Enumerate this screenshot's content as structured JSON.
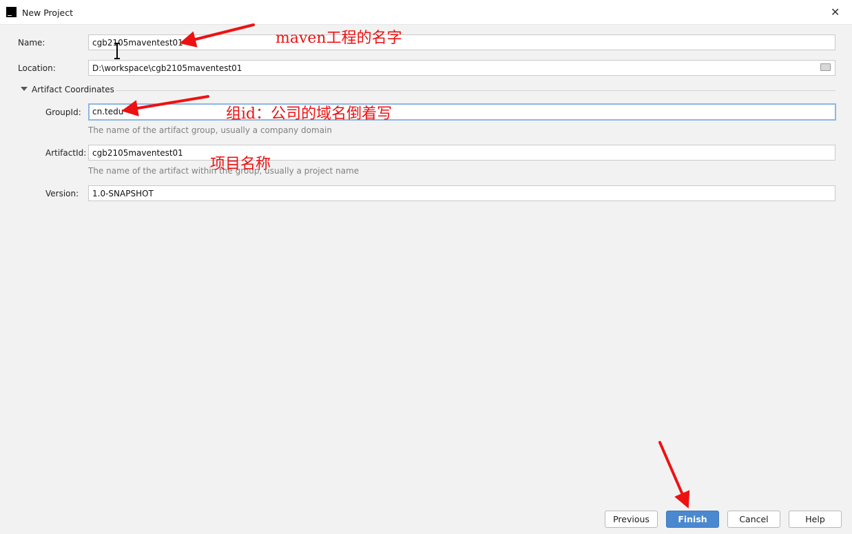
{
  "window": {
    "title": "New Project",
    "logo_text": "IJ"
  },
  "form": {
    "name": {
      "label": "Name:",
      "value": "cgb2105maventest01"
    },
    "location": {
      "label": "Location:",
      "value": "D:\\workspace\\cgb2105maventest01"
    },
    "section": {
      "label": "Artifact Coordinates",
      "expanded": true
    },
    "group_id": {
      "label": "GroupId:",
      "value": "cn.tedu",
      "hint": "The name of the artifact group, usually a company domain"
    },
    "artifact_id": {
      "label": "ArtifactId:",
      "value": "cgb2105maventest01",
      "hint": "The name of the artifact within the group, usually a project name"
    },
    "version": {
      "label": "Version:",
      "value": "1.0-SNAPSHOT"
    }
  },
  "buttons": {
    "previous": "Previous",
    "finish": "Finish",
    "cancel": "Cancel",
    "help": "Help"
  },
  "annotations": {
    "name_note": "maven工程的名字",
    "group_note": "组id：公司的域名倒着写",
    "artifact_note": "项目名称"
  },
  "colors": {
    "accent": "#4a88cf",
    "annotation": "#ee1111",
    "focus_border": "#8db6e4"
  }
}
